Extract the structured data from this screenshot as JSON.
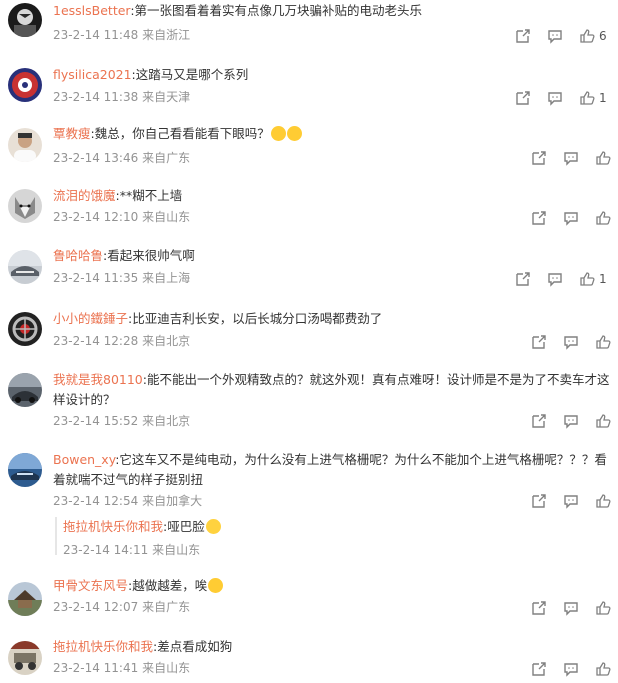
{
  "comments": [
    {
      "user": "1esslsBetter",
      "text": ":第一张图看着着实有点像几万块骗补贴的电动老头乐",
      "time": "23-2-14 11:48",
      "location": "来自浙江",
      "likes": "6"
    },
    {
      "user": "flysilica2021",
      "text": ":这踏马又是哪个系列",
      "time": "23-2-14 11:38",
      "location": "来自天津",
      "likes": "1"
    },
    {
      "user": "覃教瘦",
      "text": ":魏总，你自己看看能看下眼吗？",
      "time": "23-2-14 13:46",
      "location": "来自广东",
      "likes": ""
    },
    {
      "user": "流泪的饿魔",
      "text": ":**糊不上墙",
      "time": "23-2-14 12:10",
      "location": "来自山东",
      "likes": ""
    },
    {
      "user": "鲁哈哈鲁",
      "text": ":看起来很帅气啊",
      "time": "23-2-14 11:35",
      "location": "来自上海",
      "likes": "1"
    },
    {
      "user": "小小的鐵錘子",
      "text": ":比亚迪吉利长安，以后长城分口汤喝都费劲了",
      "time": "23-2-14 12:28",
      "location": "来自北京",
      "likes": ""
    },
    {
      "user": "我就是我80110",
      "text": ":能不能出一个外观精致点的？就这外观！真有点难呀！设计师是不是为了不卖车才这样设计的？",
      "time": "23-2-14 15:52",
      "location": "来自北京",
      "likes": ""
    },
    {
      "user": "Bowen_xy",
      "text": ":它这车又不是纯电动，为什么没有上进气格栅呢？为什么不能加个上进气格栅呢？？？看着就喘不过气的样子挺别扭",
      "time": "23-2-14 12:54",
      "location": "来自加拿大",
      "likes": ""
    },
    {
      "user": "甲骨文东风号",
      "text": ":越做越差，唉",
      "time": "23-2-14 12:07",
      "location": "来自广东",
      "likes": ""
    },
    {
      "user": "拖拉机快乐你和我",
      "text": ":差点看成如狗",
      "time": "23-2-14 11:41",
      "location": "来自山东",
      "likes": ""
    }
  ],
  "reply": {
    "user": "拖拉机快乐你和我",
    "text": ":哑巴脸",
    "time": "23-2-14 14:11",
    "location": "来自山东"
  },
  "colors": {
    "username": "#eb7350",
    "meta": "#939393",
    "icon": "#808080"
  }
}
